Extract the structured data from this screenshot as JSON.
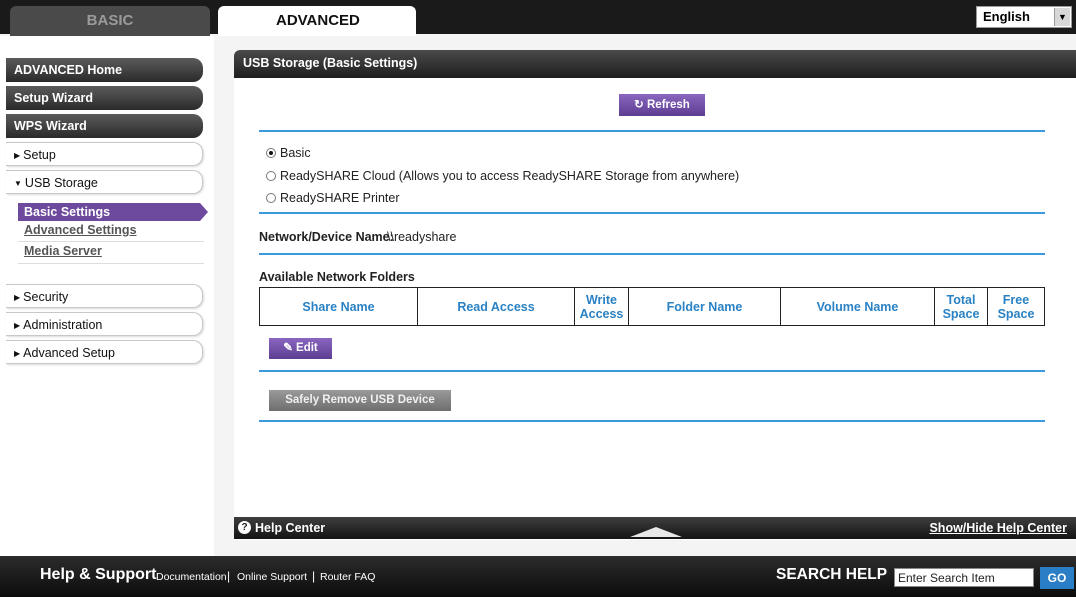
{
  "tabs": {
    "basic": "BASIC",
    "advanced": "ADVANCED"
  },
  "language": {
    "selected": "English",
    "arrow_icon": "select-arrow-icon"
  },
  "nav": {
    "advanced_home": "ADVANCED Home",
    "setup_wizard": "Setup Wizard",
    "wps_wizard": "WPS Wizard",
    "setup": "Setup",
    "usb_storage": "USB Storage",
    "usb_sub": {
      "basic_settings": "Basic Settings",
      "advanced_settings": "Advanced Settings",
      "media_server": "Media Server"
    },
    "security": "Security",
    "administration": "Administration",
    "advanced_setup": "Advanced Setup"
  },
  "main": {
    "title": "USB Storage (Basic Settings)",
    "refresh_label": "Refresh",
    "radios": [
      {
        "label": "Basic",
        "checked": true
      },
      {
        "label": "ReadySHARE Cloud (Allows you to access ReadySHARE Storage from anywhere)",
        "checked": false
      },
      {
        "label": "ReadySHARE Printer",
        "checked": false
      }
    ],
    "device_name_label": "Network/Device Name:",
    "device_name_value": "\\\\readyshare",
    "folders_label": "Available Network Folders",
    "table_headers": [
      "Share Name",
      "Read Access",
      "Write Access",
      "Folder Name",
      "Volume Name",
      "Total Space",
      "Free Space"
    ],
    "edit_label": "Edit",
    "remove_label": "Safely Remove USB Device"
  },
  "help": {
    "label": "Help Center",
    "toggle": "Show/Hide Help Center"
  },
  "footer": {
    "title": "Help & Support",
    "links": [
      "Documentation",
      "Online Support",
      "Router FAQ"
    ],
    "search_label": "SEARCH HELP",
    "search_value": "Enter Search Item",
    "go_label": "GO"
  },
  "colors": {
    "accent_purple": "#6d4a9e",
    "link_blue": "#2a82c4",
    "rule_blue": "#3a9ad9",
    "go_blue": "#2a7ec6"
  }
}
